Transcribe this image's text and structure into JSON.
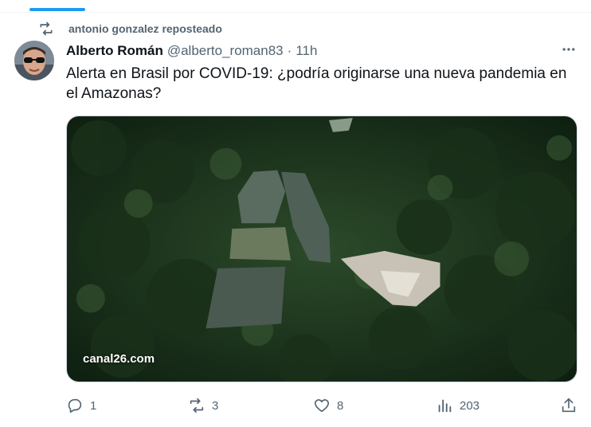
{
  "repost": {
    "text": "antonio gonzalez reposteado"
  },
  "author": {
    "name": "Alberto Román",
    "handle": "@alberto_roman83",
    "separator": "·",
    "time": "11h"
  },
  "tweet": {
    "text": "Alerta en Brasil por COVID-19: ¿podría originarse una nueva pandemia en el Amazonas?"
  },
  "media": {
    "source": "canal26.com"
  },
  "actions": {
    "replies": "1",
    "retweets": "3",
    "likes": "8",
    "views": "203"
  },
  "icons": {
    "repost": "repost-icon",
    "more": "more-icon",
    "reply": "reply-icon",
    "retweet": "retweet-icon",
    "like": "heart-icon",
    "views": "views-icon",
    "share": "share-icon"
  },
  "colors": {
    "accent": "#1d9bf0",
    "secondary_text": "#536471",
    "primary_text": "#0f1419"
  }
}
